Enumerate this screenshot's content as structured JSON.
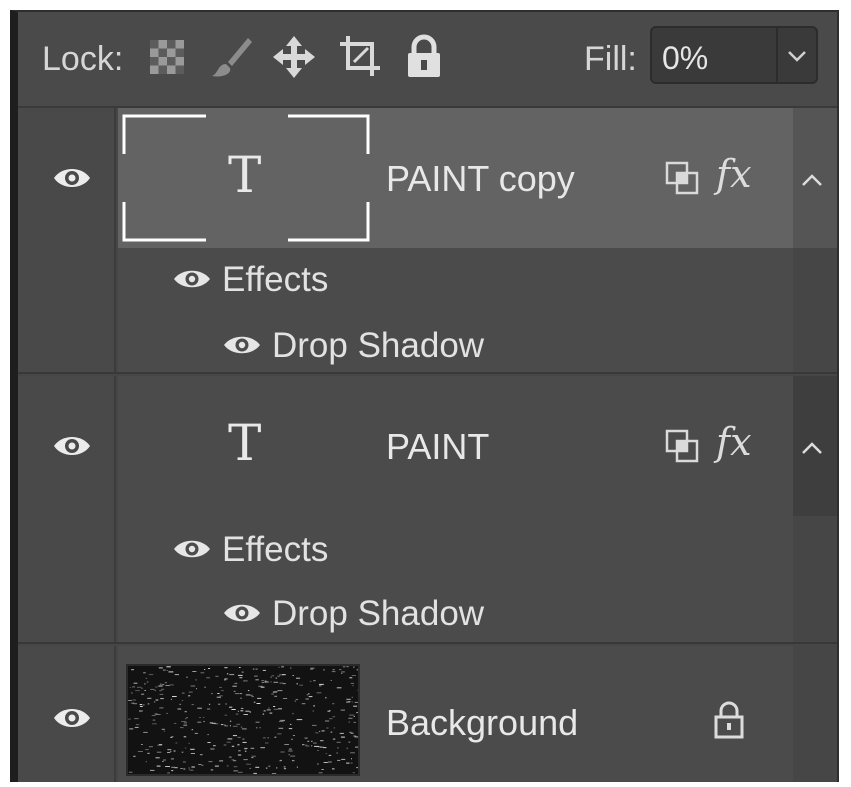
{
  "lock_bar": {
    "lock_label": "Lock:",
    "icons": [
      "lock-transparent-pixels-icon",
      "lock-image-pixels-icon",
      "lock-position-icon",
      "lock-artboard-icon",
      "lock-all-icon"
    ],
    "fill_label": "Fill:",
    "fill_value": "0%"
  },
  "layers": [
    {
      "name": "PAINT copy",
      "type": "text",
      "thumb_glyph": "T",
      "selected": true,
      "fx_label": "fx",
      "effects_label": "Effects",
      "effects": [
        "Drop Shadow"
      ]
    },
    {
      "name": "PAINT",
      "type": "text",
      "thumb_glyph": "T",
      "selected": false,
      "fx_label": "fx",
      "effects_label": "Effects",
      "effects": [
        "Drop Shadow"
      ]
    },
    {
      "name": "Background",
      "type": "image",
      "selected": false,
      "locked": true
    }
  ],
  "colors": {
    "panel": "#464646",
    "selected_row": "#636363",
    "text": "#e8e8e8"
  }
}
